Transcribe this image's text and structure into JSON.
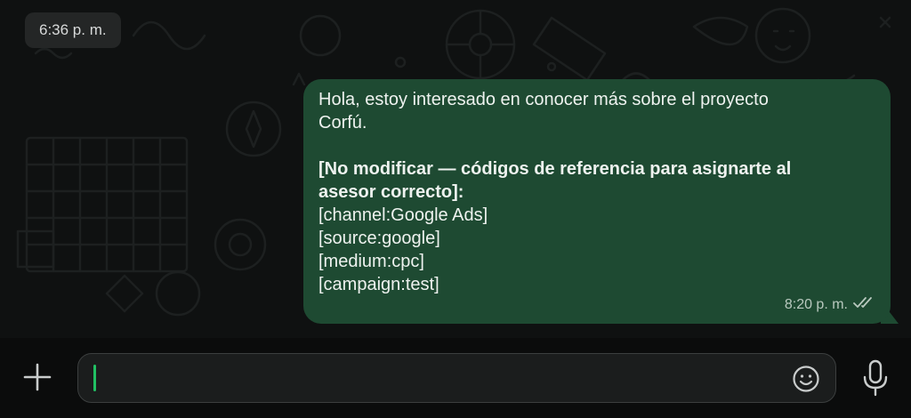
{
  "chat": {
    "date_chip": "6:36 p. m.",
    "message": {
      "lines": [
        {
          "text": "Hola, estoy interesado en conocer más sobre el proyecto",
          "bold": false
        },
        {
          "text": "Corfú.",
          "bold": false
        },
        {
          "text": "",
          "bold": false
        },
        {
          "text": "[No modificar — códigos de referencia para asignarte al",
          "bold": true
        },
        {
          "text": "asesor correcto]:",
          "bold": true
        },
        {
          "text": "[channel:Google Ads]",
          "bold": false
        },
        {
          "text": "[source:google]",
          "bold": false
        },
        {
          "text": "[medium:cpc]",
          "bold": false
        },
        {
          "text": "[campaign:test]",
          "bold": false
        }
      ],
      "time": "8:20 p. m.",
      "status_icon": "double-check-icon"
    }
  },
  "composer": {
    "input_value": "",
    "icons": {
      "attach": "plus-icon",
      "emoji": "smiley-icon",
      "voice": "microphone-icon"
    }
  },
  "colors": {
    "outgoing_bubble": "#1e4a32",
    "caret": "#21c063",
    "chat_background": "#0f1111"
  }
}
